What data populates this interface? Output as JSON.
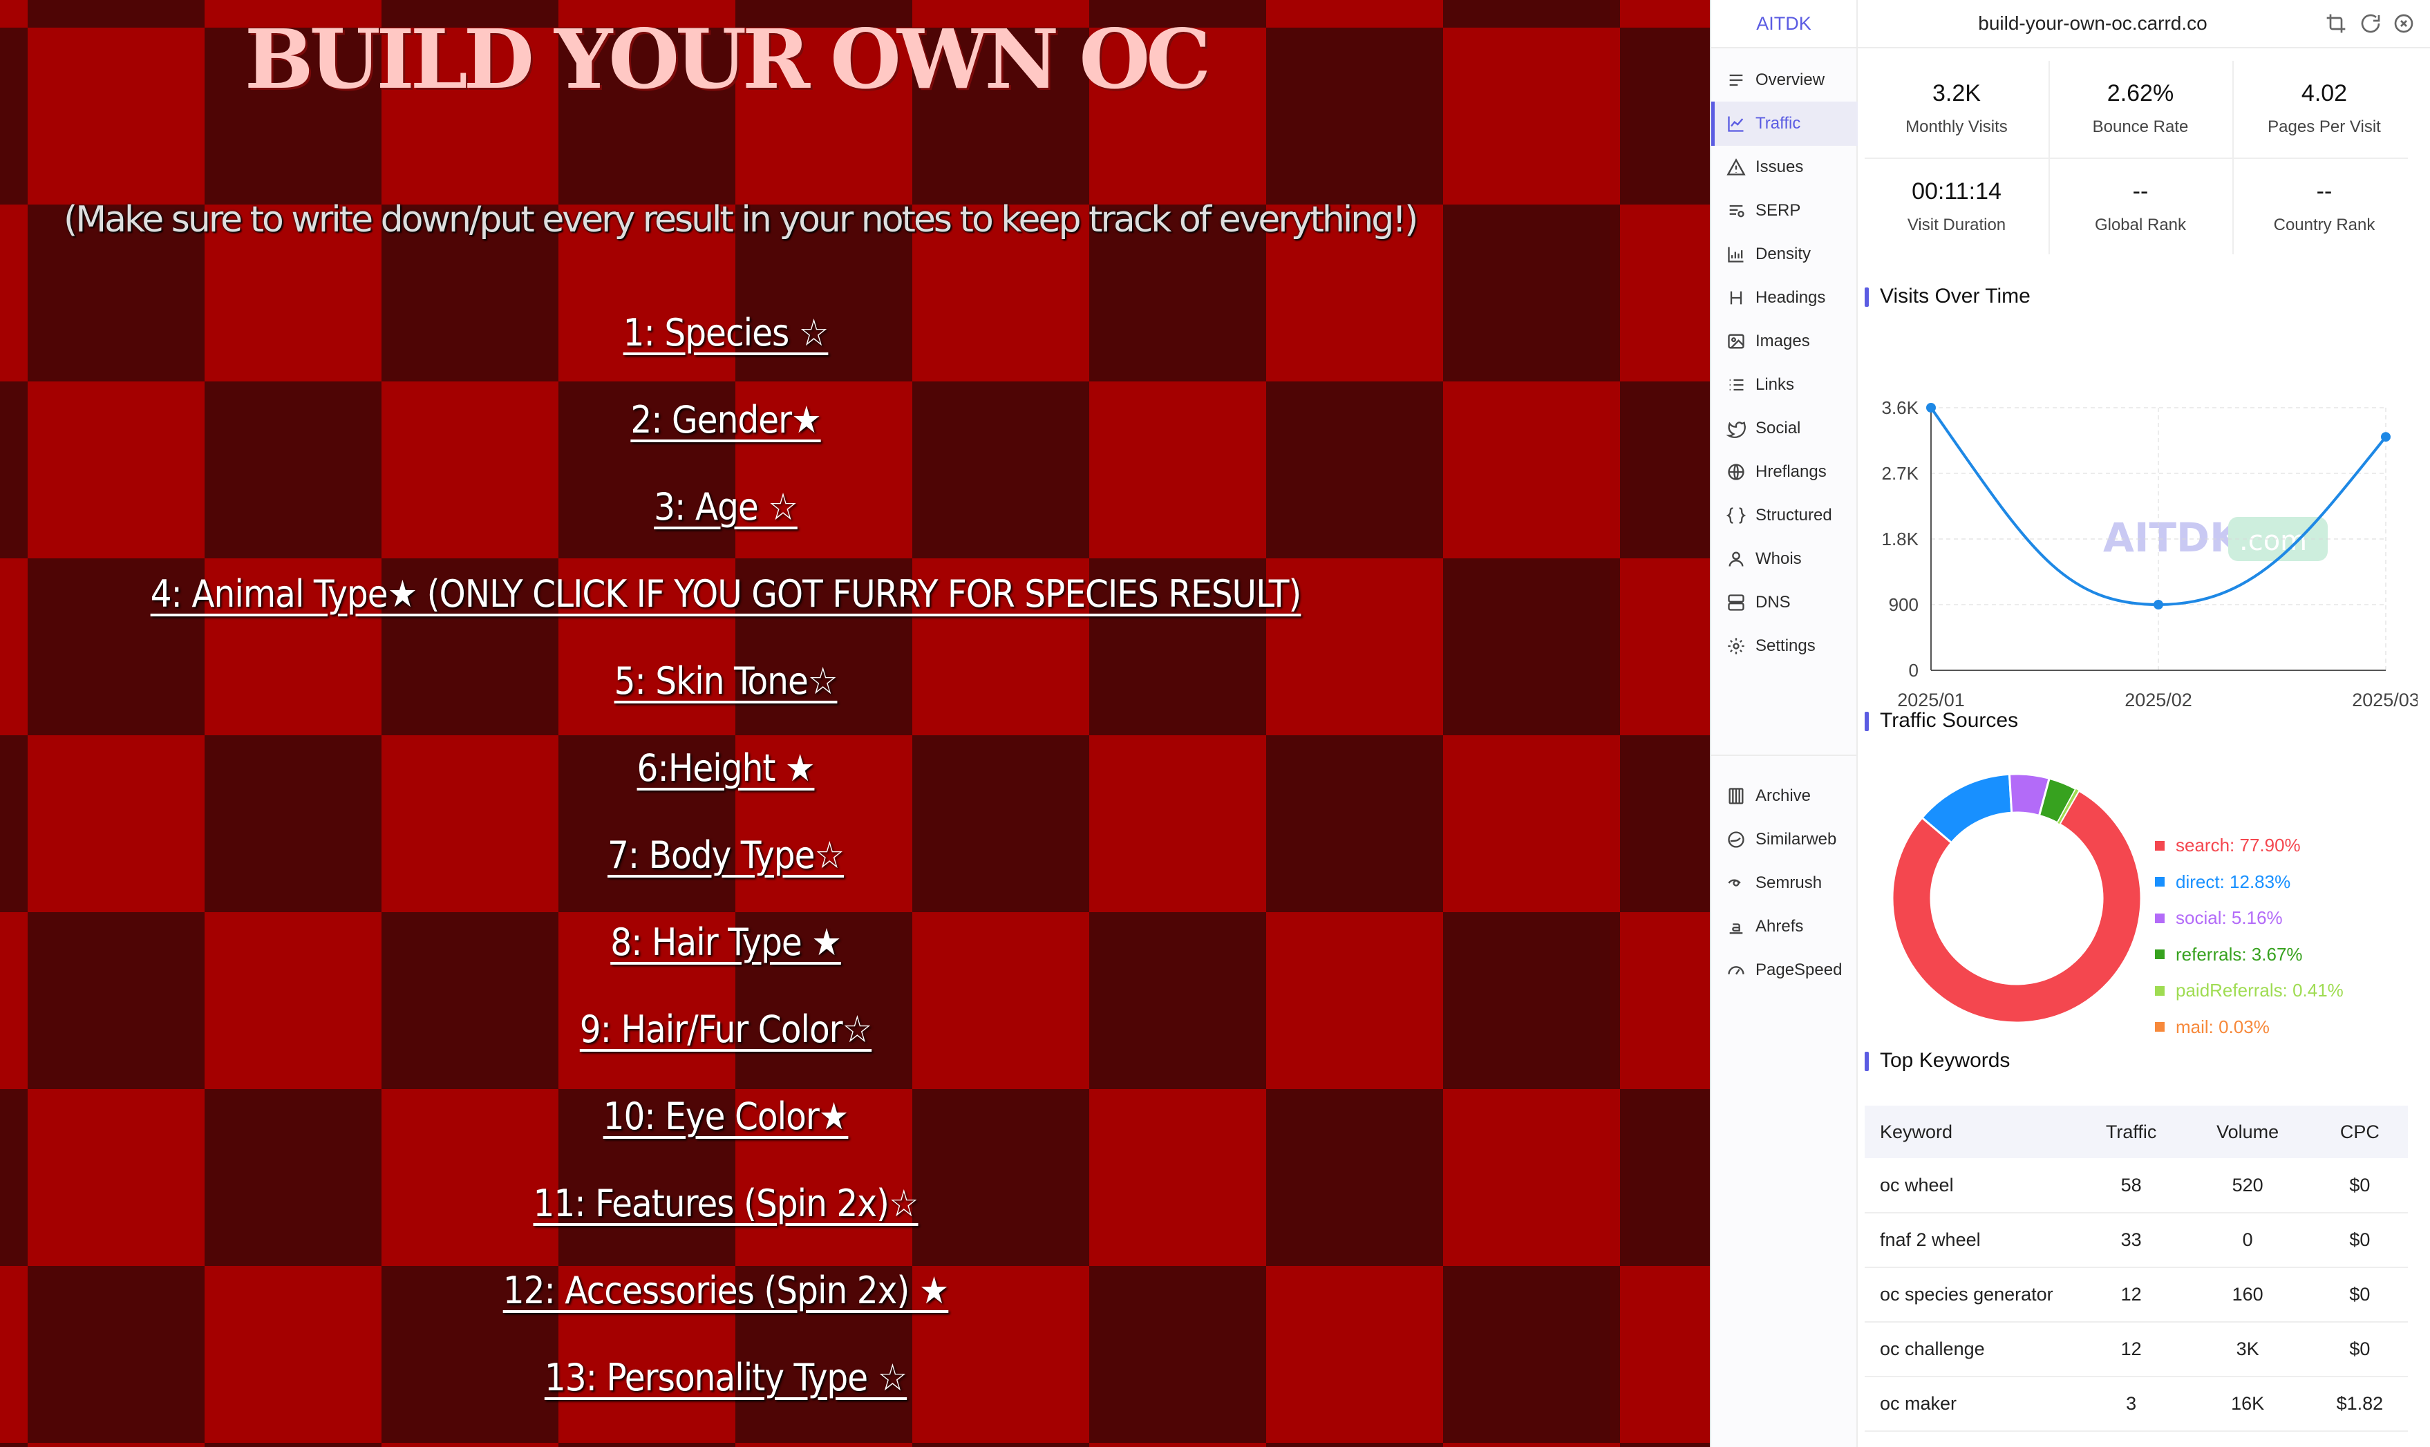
{
  "site": {
    "title": "BUILD YOUR OWN OC",
    "note": "(Make sure to write down/put every result in your notes to keep track of everything!)",
    "links": [
      "1: Species ☆",
      "2: Gender★",
      "3: Age ☆",
      "4: Animal Type★ (ONLY CLICK IF YOU GOT FURRY FOR SPECIES RESULT)",
      "5: Skin Tone☆",
      "6:Height ★",
      "7: Body Type☆",
      "8: Hair Type ★",
      "9: Hair/Fur Color☆",
      "10: Eye Color★",
      "11: Features (Spin 2x)☆",
      "12: Accessories (Spin 2x) ★",
      "13: Personality Type ☆"
    ]
  },
  "panel": {
    "brand": "AITDK",
    "domain": "build-your-own-oc.carrd.co",
    "header_icons": [
      "crop-icon",
      "refresh-icon",
      "close-icon"
    ],
    "nav": [
      {
        "label": "Overview",
        "icon": "overview-icon"
      },
      {
        "label": "Traffic",
        "icon": "traffic-icon",
        "active": true
      },
      {
        "label": "Issues",
        "icon": "warning-icon"
      },
      {
        "label": "SERP",
        "icon": "serp-icon"
      },
      {
        "label": "Density",
        "icon": "density-icon"
      },
      {
        "label": "Headings",
        "icon": "heading-icon"
      },
      {
        "label": "Images",
        "icon": "image-icon"
      },
      {
        "label": "Links",
        "icon": "links-icon"
      },
      {
        "label": "Social",
        "icon": "social-icon"
      },
      {
        "label": "Hreflangs",
        "icon": "globe-icon"
      },
      {
        "label": "Structured",
        "icon": "braces-icon"
      },
      {
        "label": "Whois",
        "icon": "user-icon"
      },
      {
        "label": "DNS",
        "icon": "server-icon"
      },
      {
        "label": "Settings",
        "icon": "gear-icon"
      }
    ],
    "external": [
      {
        "label": "Archive",
        "icon": "archive-icon"
      },
      {
        "label": "Similarweb",
        "icon": "similarweb-icon"
      },
      {
        "label": "Semrush",
        "icon": "semrush-icon"
      },
      {
        "label": "Ahrefs",
        "icon": "ahrefs-icon"
      },
      {
        "label": "PageSpeed",
        "icon": "pagespeed-icon"
      }
    ],
    "metrics": [
      {
        "value": "3.2K",
        "label": "Monthly Visits"
      },
      {
        "value": "2.62%",
        "label": "Bounce Rate"
      },
      {
        "value": "4.02",
        "label": "Pages Per Visit"
      },
      {
        "value": "00:11:14",
        "label": "Visit Duration"
      },
      {
        "value": "--",
        "label": "Global Rank"
      },
      {
        "value": "--",
        "label": "Country Rank"
      }
    ],
    "visits_title": "Visits Over Time",
    "sources_title": "Traffic Sources",
    "keywords_title": "Top Keywords",
    "watermark": {
      "text": "AITDK",
      "badge": ".com"
    },
    "keywords": {
      "headers": [
        "Keyword",
        "Traffic",
        "Volume",
        "CPC"
      ],
      "rows": [
        [
          "oc wheel",
          "58",
          "520",
          "$0"
        ],
        [
          "fnaf 2 wheel",
          "33",
          "0",
          "$0"
        ],
        [
          "oc species generator",
          "12",
          "160",
          "$0"
        ],
        [
          "oc challenge",
          "12",
          "3K",
          "$0"
        ],
        [
          "oc maker",
          "3",
          "16K",
          "$1.82"
        ]
      ]
    }
  },
  "chart_data": [
    {
      "type": "line",
      "title": "Visits Over Time",
      "x": [
        "2025/01",
        "2025/02",
        "2025/03"
      ],
      "values": [
        3600,
        900,
        3200
      ],
      "y_ticks": [
        "0",
        "900",
        "1.8K",
        "2.7K",
        "3.6K"
      ],
      "ylim": [
        0,
        3600
      ],
      "grid": true,
      "color": "#1e88e5"
    },
    {
      "type": "pie",
      "title": "Traffic Sources",
      "donut": true,
      "legend_position": "right",
      "slices": [
        {
          "name": "search",
          "value": 77.9,
          "label": "search: 77.90%",
          "color": "#f4474f"
        },
        {
          "name": "direct",
          "value": 12.83,
          "label": "direct: 12.83%",
          "color": "#1890ff"
        },
        {
          "name": "social",
          "value": 5.16,
          "label": "social: 5.16%",
          "color": "#b36bf8"
        },
        {
          "name": "referrals",
          "value": 3.67,
          "label": "referrals: 3.67%",
          "color": "#37a21f"
        },
        {
          "name": "paidReferrals",
          "value": 0.41,
          "label": "paidReferrals: 0.41%",
          "color": "#9fdc52"
        },
        {
          "name": "mail",
          "value": 0.03,
          "label": "mail: 0.03%",
          "color": "#f7893b"
        }
      ]
    }
  ]
}
